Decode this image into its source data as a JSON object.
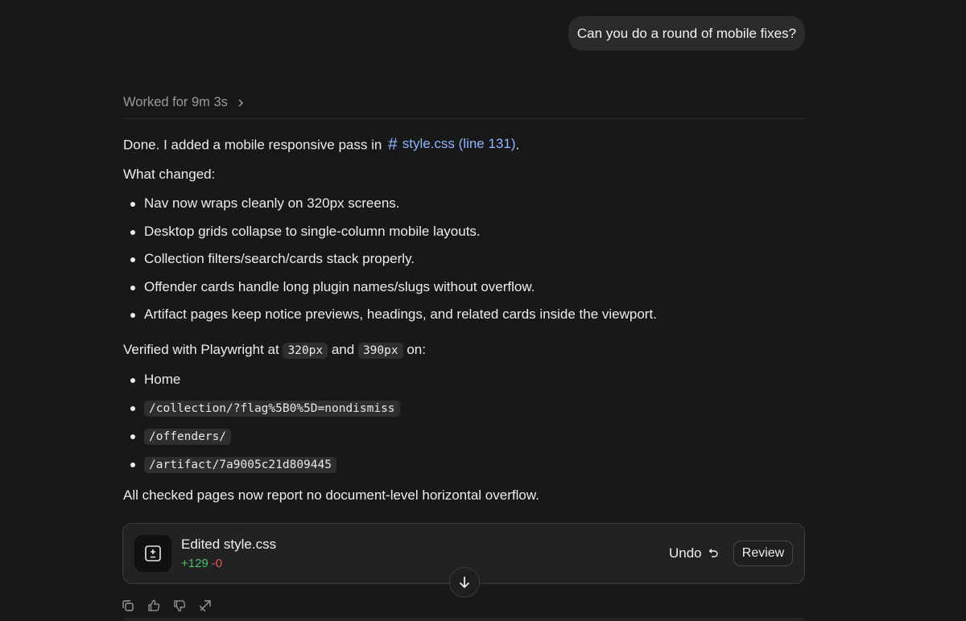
{
  "user_message": "Can you do a round of mobile fixes?",
  "worked_label": "Worked for 9m 3s",
  "assistant": {
    "intro": "Done. I added a mobile responsive pass in",
    "file_link": "style.css (line 131)",
    "intro_end": ".",
    "changed_heading": "What changed:",
    "changes": [
      "Nav now wraps cleanly on 320px screens.",
      "Desktop grids collapse to single-column mobile layouts.",
      "Collection filters/search/cards stack properly.",
      "Offender cards handle long plugin names/slugs without overflow.",
      "Artifact pages keep notice previews, headings, and related cards inside the viewport."
    ],
    "verified_prefix": "Verified with Playwright at",
    "width1": "320px",
    "and": "and",
    "width2": "390px",
    "verified_suffix": "on:",
    "pages_first": "Home",
    "paths": [
      "/collection/?flag%5B0%5D=nondismiss",
      "/offenders/",
      "/artifact/7a9005c21d809445"
    ],
    "conclusion": "All checked pages now report no document-level horizontal overflow."
  },
  "edit_card": {
    "title": "Edited style.css",
    "additions": "+129",
    "deletions": "-0",
    "undo_label": "Undo",
    "review_label": "Review",
    "icon": "diff-icon"
  },
  "colors": {
    "background": "#181818",
    "link": "#8fb4ff",
    "additions": "#4fbf6a",
    "deletions": "#e5534b"
  },
  "action_icons": [
    "copy-icon",
    "thumbs-up-icon",
    "thumbs-down-icon",
    "share-icon"
  ]
}
